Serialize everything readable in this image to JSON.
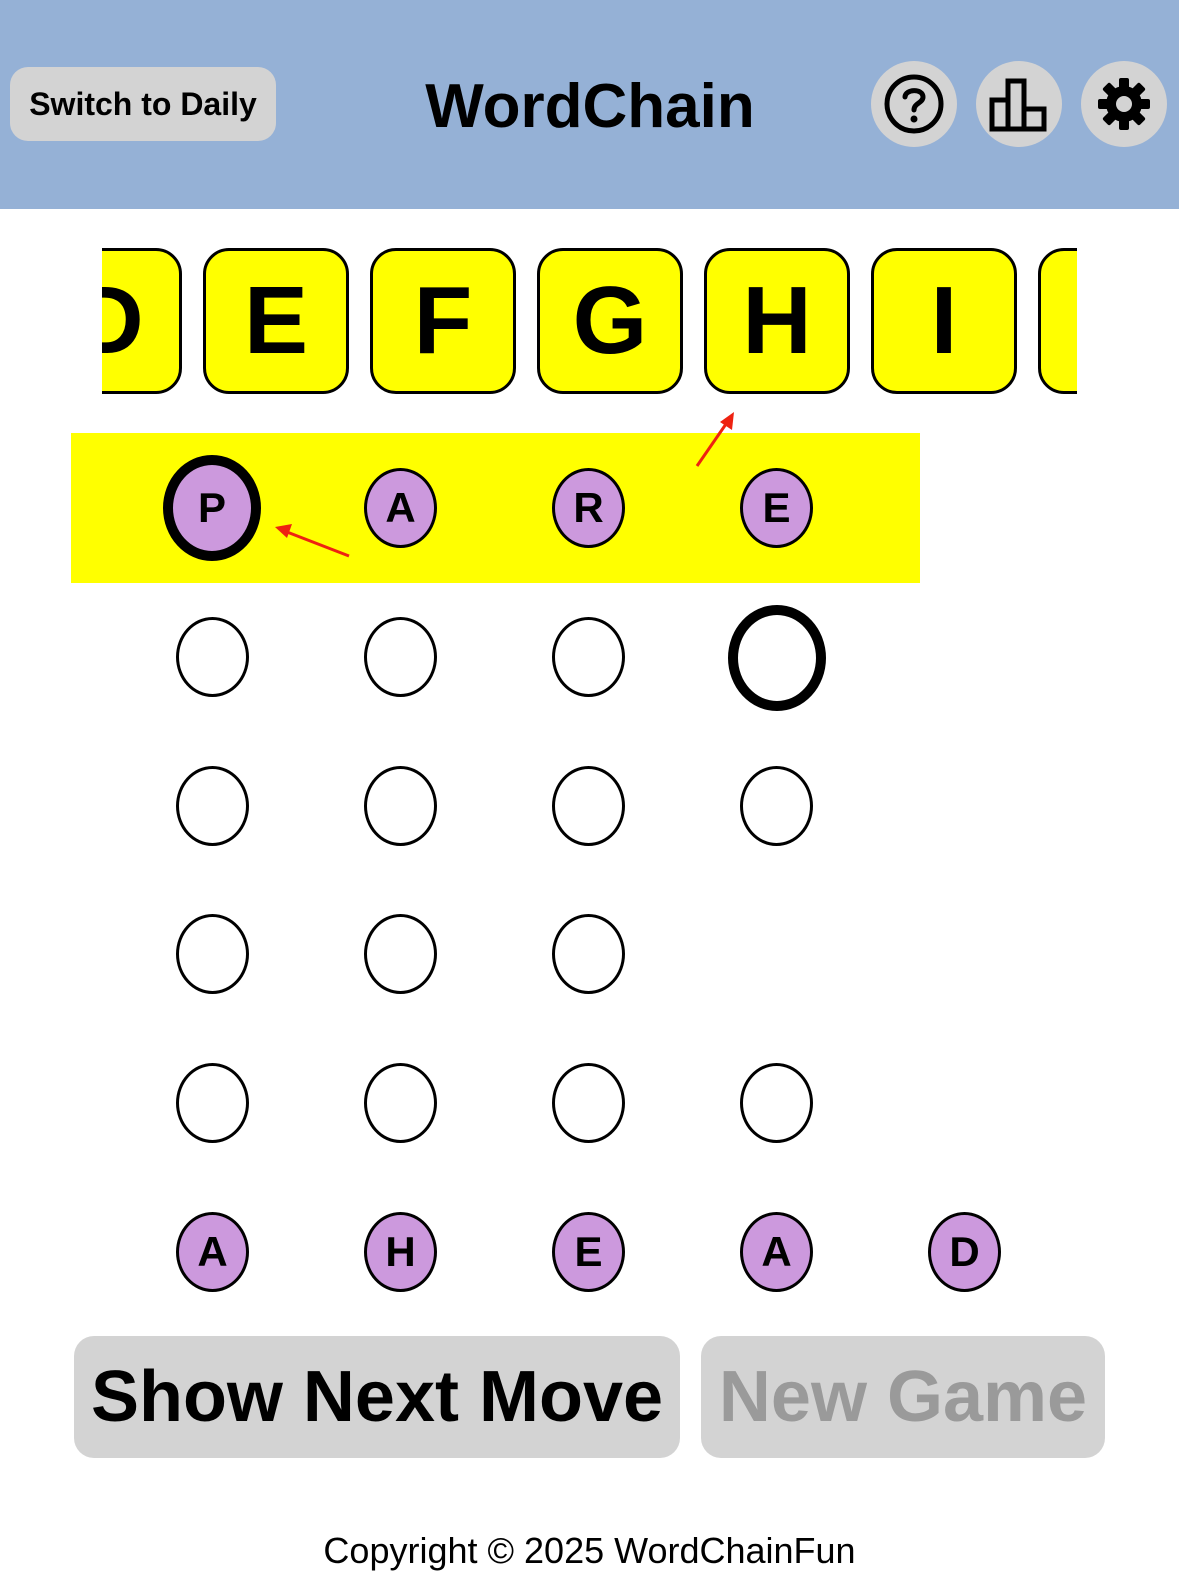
{
  "header": {
    "switch_label": "Switch to Daily",
    "title": "WordChain",
    "help_icon": "question-circle-icon",
    "stats_icon": "podium-chart-icon",
    "settings_icon": "gear-icon",
    "background_color": "#95b1d6"
  },
  "letter_strip": {
    "tiles": [
      "D",
      "E",
      "F",
      "G",
      "H",
      "I",
      ""
    ],
    "tile_color": "#ffff00"
  },
  "board": {
    "slot_fill_color": "#cc99dd",
    "rows": [
      [
        "P",
        "A",
        "R",
        "E"
      ],
      [
        "",
        "",
        "",
        ""
      ],
      [
        "",
        "",
        "",
        ""
      ],
      [
        "",
        "",
        ""
      ],
      [
        "",
        "",
        "",
        ""
      ],
      [
        "A",
        "H",
        "E",
        "A",
        "D"
      ]
    ]
  },
  "buttons": {
    "show_next_move": "Show Next Move",
    "new_game": "New Game"
  },
  "footer": {
    "copyright": "Copyright © 2025 WordChainFun"
  }
}
